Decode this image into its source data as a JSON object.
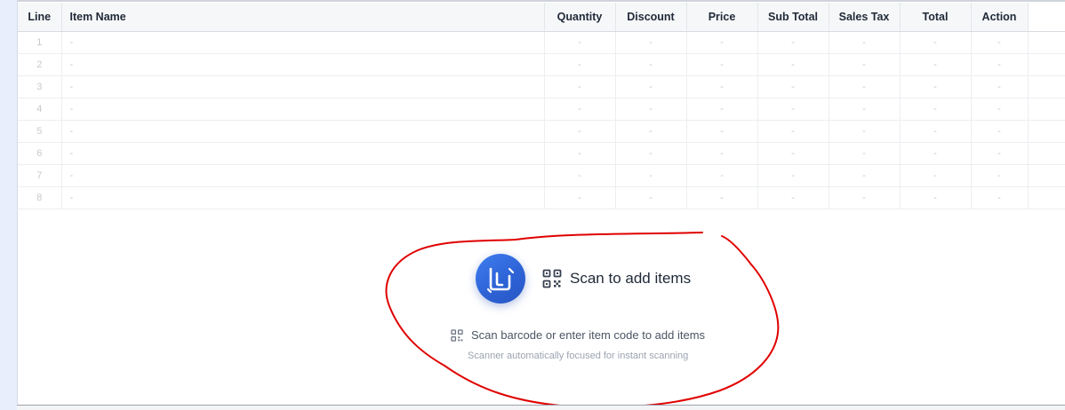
{
  "table": {
    "headers": {
      "line": "Line",
      "item_name": "Item Name",
      "quantity": "Quantity",
      "discount": "Discount",
      "price": "Price",
      "sub_total": "Sub Total",
      "sales_tax": "Sales Tax",
      "total": "Total",
      "action": "Action"
    },
    "placeholder": "-",
    "rows": [
      {
        "line": "1"
      },
      {
        "line": "2"
      },
      {
        "line": "3"
      },
      {
        "line": "4"
      },
      {
        "line": "5"
      },
      {
        "line": "6"
      },
      {
        "line": "7"
      },
      {
        "line": "8"
      }
    ]
  },
  "scan": {
    "title": "Scan to add items",
    "subtitle": "Scan barcode or enter item code to add items",
    "hint": "Scanner automatically focused for instant scanning"
  },
  "icons": {
    "logo": "app-logo-icon",
    "qr": "qr-code-icon"
  },
  "colors": {
    "accent": "#3370e8",
    "annotation": "#e00000",
    "header_bg": "#f6f7f9"
  }
}
